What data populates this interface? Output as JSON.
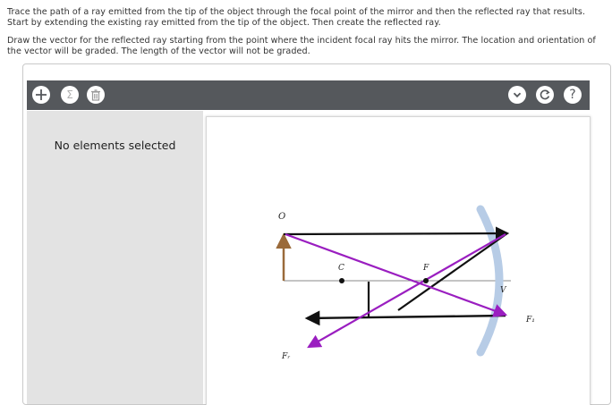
{
  "instructions": {
    "line1": "Trace the path of a ray emitted from the tip of the object through the focal point of the mirror and then the reflected ray that results. Start by extending the existing ray emitted from the tip of the object. Then create the reflected ray.",
    "line2": "Draw the vector for the reflected ray starting from the point where the incident focal ray hits the mirror. The location and orientation of the vector will be graded. The length of the vector will not be graded."
  },
  "toolbar": {
    "left_icons": [
      "plus-icon",
      "sigma-icon",
      "trash-icon"
    ],
    "right_icons": [
      "chevron-down-icon",
      "reset-icon",
      "help-icon"
    ],
    "sigma_symbol": "Σ",
    "help_symbol": "?"
  },
  "panel": {
    "empty_text": "No elements selected"
  },
  "diagram": {
    "labels": {
      "object": "O",
      "center": "C",
      "focus": "F",
      "vertex": "V",
      "ray_1": "F₁",
      "ray_r": "Fᵣ"
    },
    "colors": {
      "mirror": "#b7cce6",
      "object_arrow": "#9a6a3a",
      "ray_black": "#111111",
      "ray_purple": "#9a1ec0",
      "axis": "#8a8a8a"
    }
  }
}
